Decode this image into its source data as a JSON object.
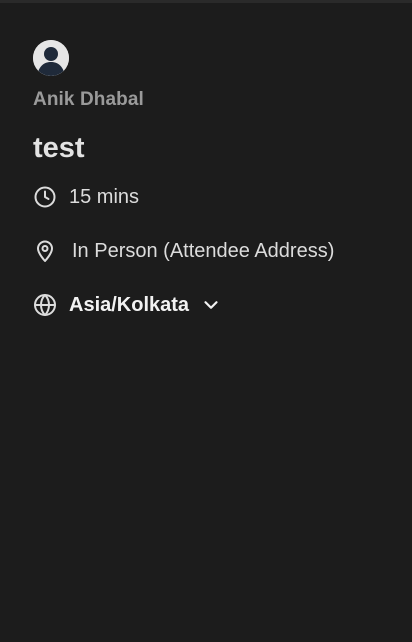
{
  "profile": {
    "organizer_name": "Anik Dhabal",
    "avatar_icon": "user-avatar-icon"
  },
  "event": {
    "title": "test",
    "duration": "15 mins",
    "duration_icon": "clock-icon",
    "location": "In Person (Attendee Address)",
    "location_icon": "map-pin-icon",
    "timezone": "Asia/Kolkata",
    "timezone_icon": "globe-icon",
    "timezone_dropdown_icon": "chevron-down-icon"
  },
  "colors": {
    "background": "#1c1c1c",
    "top_border": "#2a2a2a",
    "organizer_text": "#9a9a9a",
    "primary_text": "#e3e3e3"
  }
}
